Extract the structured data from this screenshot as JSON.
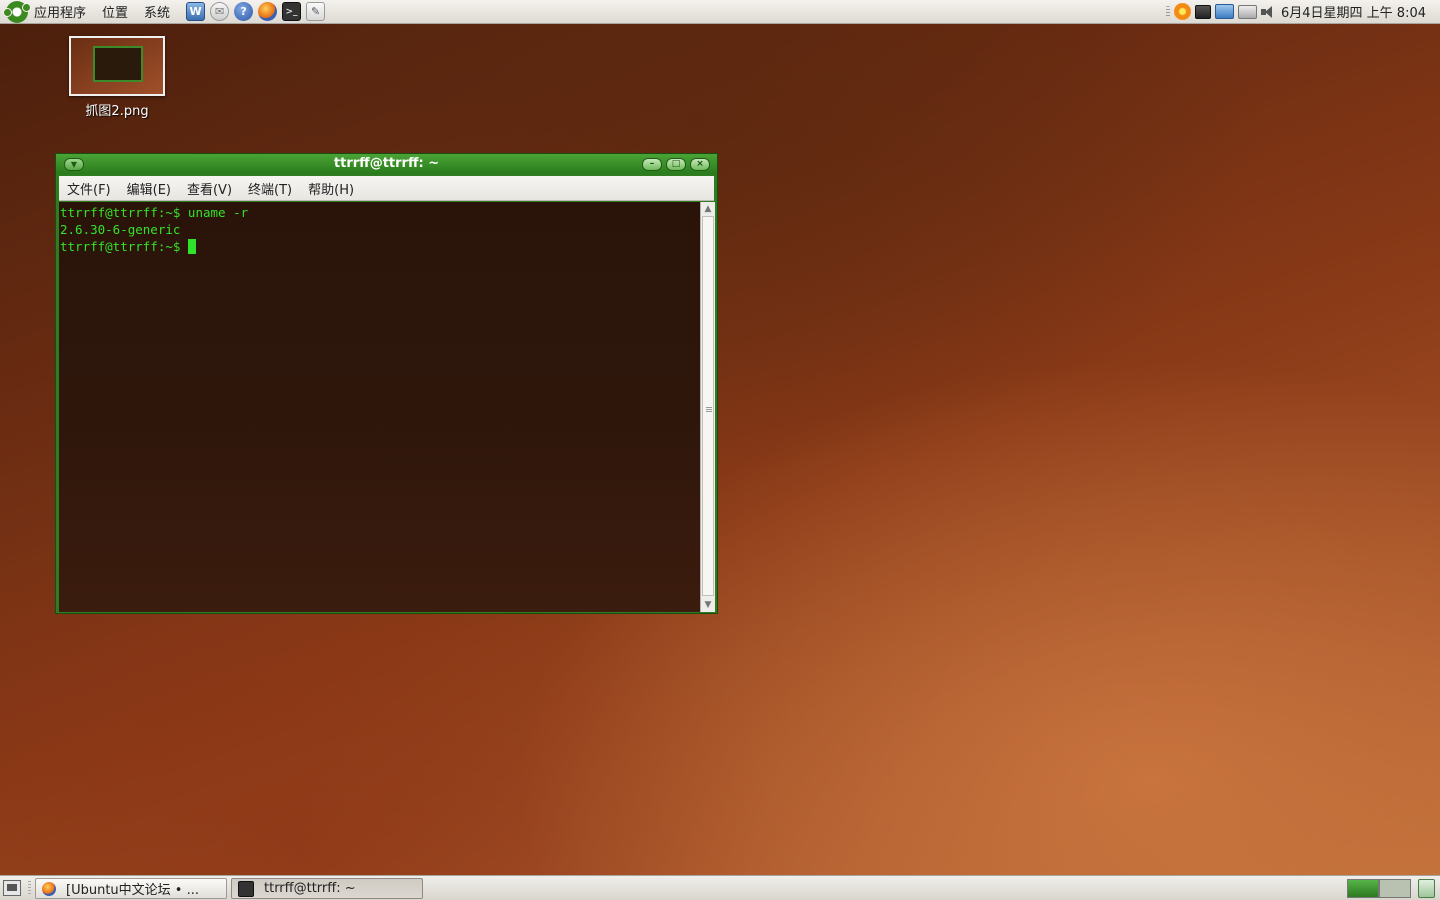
{
  "top_panel": {
    "menus": [
      "应用程序",
      "位置",
      "系统"
    ],
    "launchers": [
      "system-monitor-icon",
      "mail-icon",
      "help-icon",
      "firefox-icon",
      "terminal-icon",
      "text-editor-icon"
    ],
    "clock": "6月4日星期四 上午 8:04"
  },
  "desktop": {
    "icon_label": "抓图2.png"
  },
  "terminal": {
    "title": "ttrrff@ttrrff: ~",
    "menu": [
      "文件(F)",
      "编辑(E)",
      "查看(V)",
      "终端(T)",
      "帮助(H)"
    ],
    "lines": [
      "ttrrff@ttrrff:~$ uname -r",
      "2.6.30-6-generic",
      "ttrrff@ttrrff:~$ "
    ],
    "colors": {
      "text": "#35e12a",
      "frame": "#2f7d20"
    }
  },
  "bottom_panel": {
    "tasks": [
      {
        "label": "[Ubuntu中文论坛 • ...",
        "icon": "firefox-icon"
      },
      {
        "label": "ttrrff@ttrrff: ~",
        "icon": "terminal-icon"
      }
    ]
  }
}
